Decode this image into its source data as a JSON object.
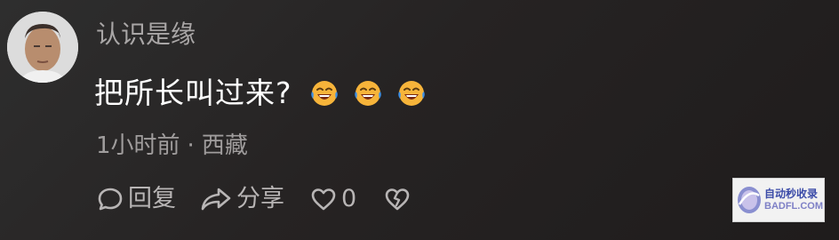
{
  "comment": {
    "username": "认识是缘",
    "text": "把所长叫过来?",
    "emojis": [
      "laughing-crying-face",
      "laughing-crying-face",
      "laughing-crying-face"
    ],
    "time": "1小时前",
    "separator": "·",
    "location": "西藏"
  },
  "actions": {
    "reply_label": "回复",
    "share_label": "分享",
    "like_count": "0"
  },
  "watermark": {
    "line1": "自动秒收录",
    "line2": "BADFL.COM"
  },
  "colors": {
    "background": "#262323",
    "username": "#a9a6a6",
    "meta": "#a09d9d",
    "action": "#b8b5b5",
    "emoji": "#f7b43a"
  }
}
